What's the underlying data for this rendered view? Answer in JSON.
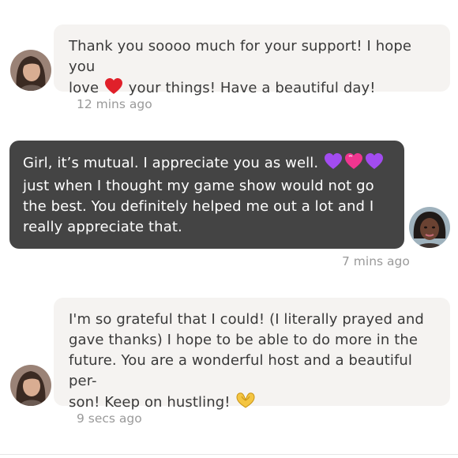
{
  "messages": [
    {
      "lines": [
        "Thank you soooo much for your support! I hope you",
        "love",
        "your things! Have a beautiful day!"
      ],
      "emoji": [
        "red-heart"
      ],
      "timestamp": "12 mins ago"
    },
    {
      "lines": [
        "Girl, it’s mutual. I appreciate you as well.",
        "just when I thought my game show would not go",
        "the best. You definitely helped me out a lot and I",
        "really appreciate that."
      ],
      "emoji": [
        "purple-heart",
        "pink-heart",
        "purple-heart"
      ],
      "timestamp": "7 mins ago"
    },
    {
      "lines": [
        "I'm so grateful that I could! (I literally prayed and",
        "gave thanks) I hope to be able to do more in the",
        "future. You are a wonderful host and a beautiful per-",
        "son! Keep on hustling!"
      ],
      "emoji": [
        "heart-hands"
      ],
      "timestamp": "9 secs ago"
    }
  ],
  "colors": {
    "incoming_bubble": "#f5f3f1",
    "outgoing_bubble": "#444444",
    "timestamp": "#9a9a9a",
    "red_heart": "#e0202a",
    "purple_heart": "#a24cf0",
    "pink_heart": "#f0358f",
    "heart_hands": "#f4c542"
  }
}
